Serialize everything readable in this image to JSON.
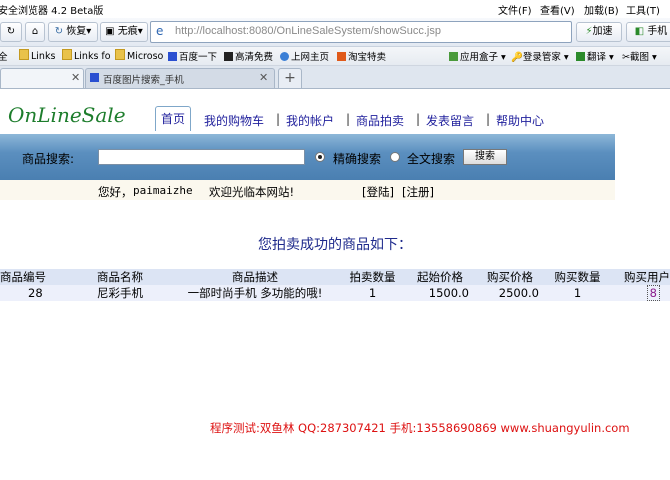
{
  "browser": {
    "title": "安全浏览器 4.2 Beta版",
    "menu": [
      "文件(F)",
      "查看(V)",
      "加载(B)",
      "工具(T)"
    ],
    "back_label": "恢复",
    "proxy_label": "无痕",
    "url": "http://localhost:8080/OnLineSaleSystem/showSucc.jsp",
    "accelerate_label": "加速",
    "mobile_label": "手机",
    "bookmarks": [
      "全",
      "Links",
      "Links fo",
      "Microso",
      "百度一下",
      "高清免费",
      "上网主页",
      "淘宝特卖"
    ],
    "right_tools": [
      "应用盒子",
      "登录管家",
      "翻译",
      "截图"
    ],
    "active_tab": "百度图片搜索_手机"
  },
  "page": {
    "logo": "OnLineSale",
    "nav": [
      "首页",
      "我的购物车",
      "我的帐户",
      "商品拍卖",
      "发表留言",
      "帮助中心"
    ],
    "search": {
      "label": "商品搜索:",
      "value": "",
      "option_exact": "精确搜索",
      "option_full": "全文搜索",
      "button": "搜索"
    },
    "welcome": {
      "greeting": "您好，",
      "user": "paimaizhe",
      "message": "欢迎光临本网站!",
      "login": "[登陆]",
      "register": "[注册]"
    },
    "heading": "您拍卖成功的商品如下：",
    "table": {
      "headers": [
        "商品编号",
        "商品名称",
        "商品描述",
        "拍卖数量",
        "起始价格",
        "购买价格",
        "购买数量",
        "购买用户"
      ],
      "rows": [
        [
          "28",
          "尼彩手机",
          "一部时尚手机 多功能的哦!",
          "1",
          "1500.0",
          "2500.0",
          "1",
          "8"
        ]
      ]
    },
    "footer": "程序测试:双鱼林 QQ:287307421 手机:13558690869 www.shuangyulin.com"
  },
  "colors": {
    "logo": "#1d7d2c",
    "nav_text": "#1f1f9c",
    "heading": "#1e2a8c",
    "footer": "#dd1111"
  }
}
